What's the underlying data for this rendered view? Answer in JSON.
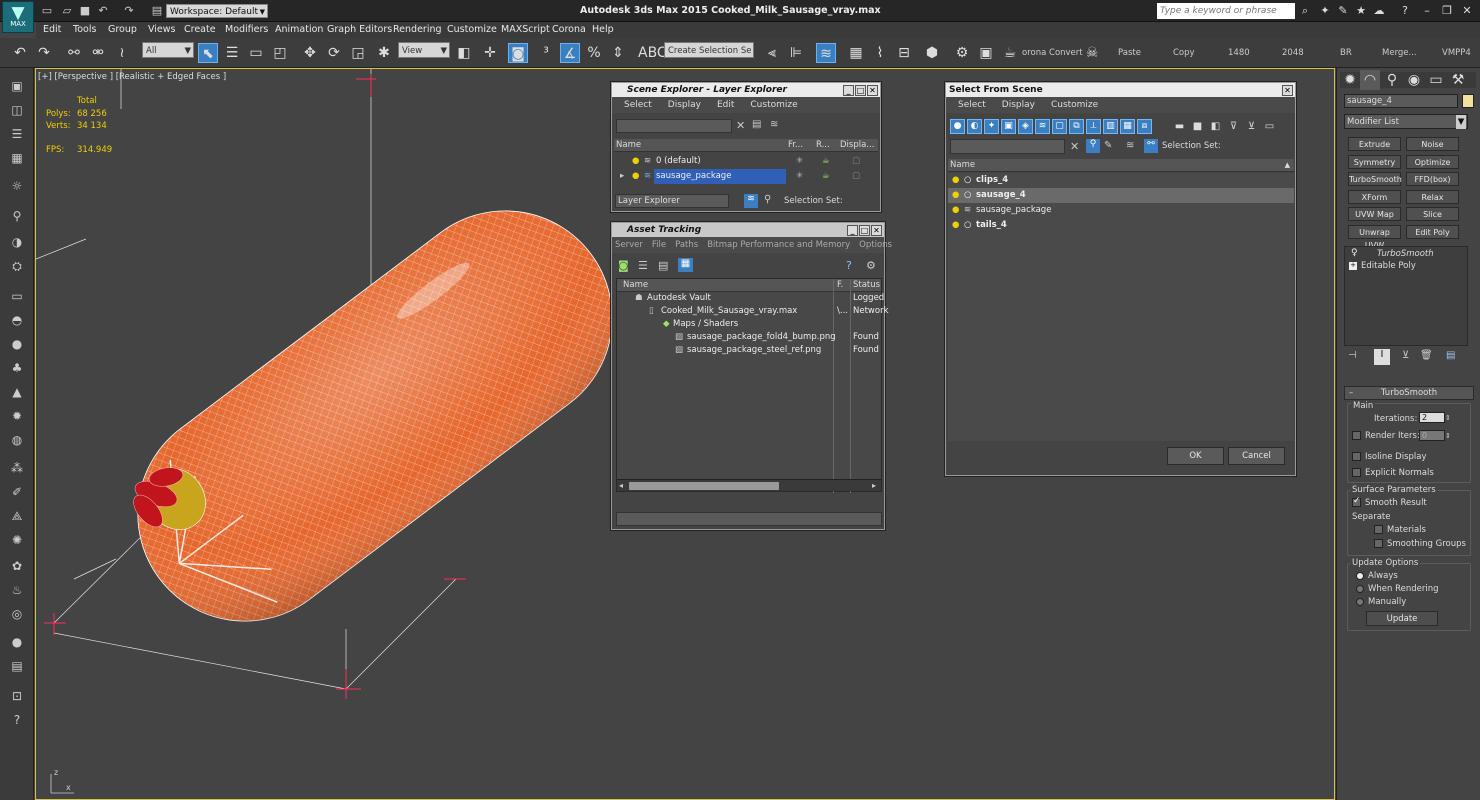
{
  "app": {
    "title": "Autodesk 3ds Max  2015    Cooked_Milk_Sausage_vray.max",
    "logo_text": "MAX",
    "workspace": "Workspace: Default",
    "search_placeholder": "Type a keyword or phrase"
  },
  "menus": [
    "Edit",
    "Tools",
    "Group",
    "Views",
    "Create",
    "Modifiers",
    "Animation",
    "Graph Editors",
    "Rendering",
    "Customize",
    "MAXScript",
    "Corona",
    "Help"
  ],
  "toolbar": {
    "filter": "All",
    "ref_coord": "View",
    "selection_set": "Create Selection Se",
    "corona_convert": "orona Convert",
    "paste": "Paste",
    "copy": "Copy",
    "n1480": "1480",
    "n2048": "2048",
    "br": "BR",
    "merge": "Merge...",
    "vmpp4": "VMPP4"
  },
  "viewport": {
    "label": "[+] [Perspective ] [Realistic + Edged Faces ]",
    "stats": {
      "total": "Total",
      "polys_label": "Polys:",
      "polys": "68 256",
      "verts_label": "Verts:",
      "verts": "34 134",
      "fps_label": "FPS:",
      "fps": "314.949"
    },
    "axis_x": "x",
    "axis_z": "z",
    "colors": {
      "sausage": "#e6672d",
      "wire": "#ffffff",
      "clip": "#c0151c",
      "band": "#c8a51c",
      "selection": "#ff2d55",
      "viewport_border": "#d8c04a"
    }
  },
  "scene_explorer": {
    "title": "Scene Explorer - Layer Explorer",
    "menus": [
      "Select",
      "Display",
      "Edit",
      "Customize"
    ],
    "columns": [
      "Name",
      "Fr...",
      "R...",
      "Displa..."
    ],
    "layers": [
      {
        "name": "0 (default)"
      },
      {
        "name": "sausage_package"
      }
    ],
    "footer_mode": "Layer Explorer",
    "footer_set": "Selection Set:"
  },
  "asset_tracking": {
    "title": "Asset Tracking",
    "menus": [
      "Server",
      "File",
      "Paths",
      "Bitmap Performance and Memory",
      "Options"
    ],
    "columns": [
      "Name",
      "F.",
      "Status"
    ],
    "rows": [
      {
        "name": "Autodesk Vault",
        "f": "",
        "status": "Logged"
      },
      {
        "name": "Cooked_Milk_Sausage_vray.max",
        "f": "\\...",
        "status": "Network"
      },
      {
        "name": "Maps / Shaders",
        "f": "",
        "status": ""
      },
      {
        "name": "sausage_package_fold4_bump.png",
        "f": "",
        "status": "Found"
      },
      {
        "name": "sausage_package_steel_ref.png",
        "f": "",
        "status": "Found"
      }
    ]
  },
  "select_from_scene": {
    "title": "Select From Scene",
    "menus": [
      "Select",
      "Display",
      "Customize"
    ],
    "selection_set": "Selection Set:",
    "column": "Name",
    "items": [
      {
        "name": "clips_4"
      },
      {
        "name": "sausage_4"
      },
      {
        "name": "sausage_package"
      },
      {
        "name": "tails_4"
      }
    ],
    "ok": "OK",
    "cancel": "Cancel"
  },
  "command_panel": {
    "object_name": "sausage_4",
    "modifier_list": "Modifier List",
    "modifier_buttons": [
      "Extrude",
      "Noise",
      "Symmetry",
      "Optimize",
      "TurboSmooth",
      "FFD(box)",
      "XForm",
      "Relax",
      "UVW Map",
      "Slice",
      "Unwrap UVW",
      "Edit Poly"
    ],
    "stack": [
      "TurboSmooth",
      "Editable Poly"
    ],
    "rollout_title": "TurboSmooth",
    "main": "Main",
    "iterations_label": "Iterations:",
    "iterations": "2",
    "render_iters_label": "Render Iters:",
    "render_iters": "0",
    "isoline": "Isoline Display",
    "explicit_normals": "Explicit Normals",
    "surface_params": "Surface Parameters",
    "smooth_result": "Smooth Result",
    "separate": "Separate",
    "materials": "Materials",
    "smoothing_groups": "Smoothing Groups",
    "update_options": "Update Options",
    "always": "Always",
    "when_rendering": "When Rendering",
    "manually": "Manually",
    "update": "Update"
  }
}
